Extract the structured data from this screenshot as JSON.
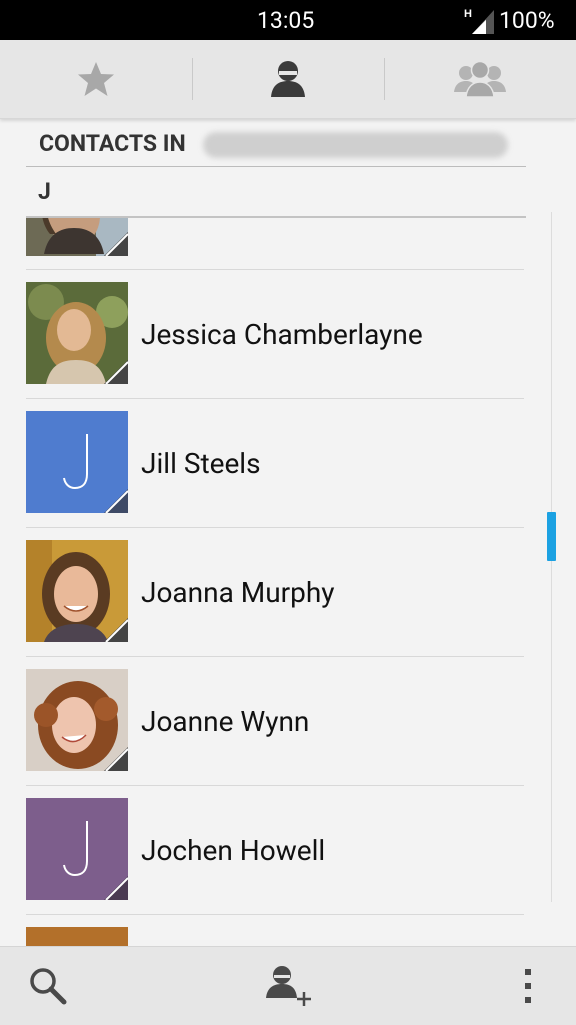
{
  "status_bar": {
    "time": "13:05",
    "network_type": "H",
    "battery": "100%"
  },
  "tabs": [
    {
      "icon": "star-icon",
      "label": "Favorites",
      "selected": false
    },
    {
      "icon": "person-icon",
      "label": "Contacts",
      "selected": true
    },
    {
      "icon": "group-icon",
      "label": "Groups",
      "selected": false
    }
  ],
  "header": {
    "title": "CONTACTS IN",
    "account_redacted": true
  },
  "section": {
    "letter": "J"
  },
  "contacts": [
    {
      "name": "",
      "avatar": "photo-partial"
    },
    {
      "name": "Jessica Chamberlayne",
      "avatar": "photo"
    },
    {
      "name": "Jill Steels",
      "avatar": "letter",
      "letter": "J",
      "color": "#4f7ccf"
    },
    {
      "name": "Joanna Murphy",
      "avatar": "photo"
    },
    {
      "name": "Joanne Wynn",
      "avatar": "photo"
    },
    {
      "name": "Jochen Howell",
      "avatar": "letter",
      "letter": "J",
      "color": "#7d5e8c"
    },
    {
      "name": "",
      "avatar": "color-partial",
      "color": "#b3702a"
    }
  ],
  "bottom_bar": {
    "search_icon": "search-icon",
    "add_contact_icon": "add-contact-icon",
    "overflow_icon": "overflow-menu-icon"
  },
  "colors": {
    "accent": "#1ba1e2",
    "background": "#f3f3f3",
    "bar": "#e6e6e6"
  }
}
